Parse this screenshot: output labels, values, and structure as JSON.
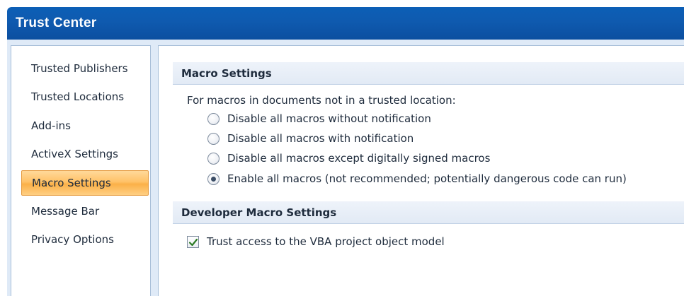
{
  "window": {
    "title": "Trust Center"
  },
  "sidebar": {
    "items": [
      {
        "label": "Trusted Publishers",
        "selected": false
      },
      {
        "label": "Trusted Locations",
        "selected": false
      },
      {
        "label": "Add-ins",
        "selected": false
      },
      {
        "label": "ActiveX Settings",
        "selected": false
      },
      {
        "label": "Macro Settings",
        "selected": true
      },
      {
        "label": "Message Bar",
        "selected": false
      },
      {
        "label": "Privacy Options",
        "selected": false
      }
    ]
  },
  "macro_settings": {
    "header": "Macro Settings",
    "intro": "For macros in documents not in a trusted location:",
    "options": [
      {
        "label": "Disable all macros without notification",
        "checked": false
      },
      {
        "label": "Disable all macros with notification",
        "checked": false
      },
      {
        "label": "Disable all macros except digitally signed macros",
        "checked": false
      },
      {
        "label": "Enable all macros (not recommended; potentially dangerous code can run)",
        "checked": true
      }
    ]
  },
  "developer_settings": {
    "header": "Developer Macro Settings",
    "trust_vba_label": "Trust access to the VBA project object model",
    "trust_vba_checked": true
  },
  "colors": {
    "titlebar": "#0c5fb6",
    "selected_item": "#ffc268",
    "pane_border": "#a7bed8"
  }
}
